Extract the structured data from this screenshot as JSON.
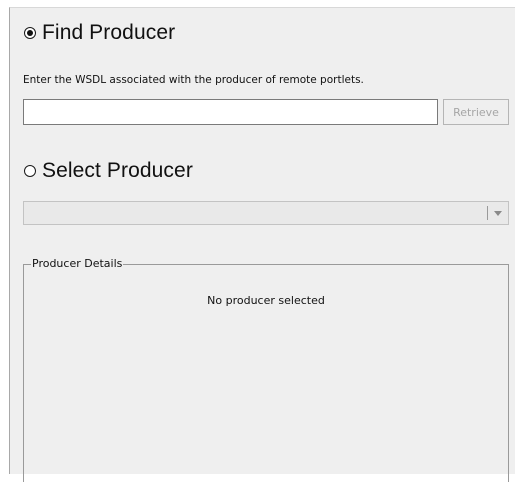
{
  "find_producer": {
    "option_label": "Find Producer",
    "selected": true,
    "instruction": "Enter the WSDL associated with the producer of remote portlets.",
    "wsdl_input": {
      "value": "",
      "placeholder": ""
    },
    "retrieve_button_label": "Retrieve"
  },
  "select_producer": {
    "option_label": "Select Producer",
    "selected": false,
    "dropdown": {
      "selected_value": "",
      "enabled": false
    }
  },
  "producer_details": {
    "legend": "Producer Details",
    "empty_message": "No producer selected"
  },
  "icons": {
    "dropdown_arrow": "chevron-down-icon",
    "radio_selected": "radio-selected",
    "radio_unselected": "radio-unselected"
  },
  "colors": {
    "panel_background": "#efefef",
    "disabled_text": "#a6a6a6"
  }
}
